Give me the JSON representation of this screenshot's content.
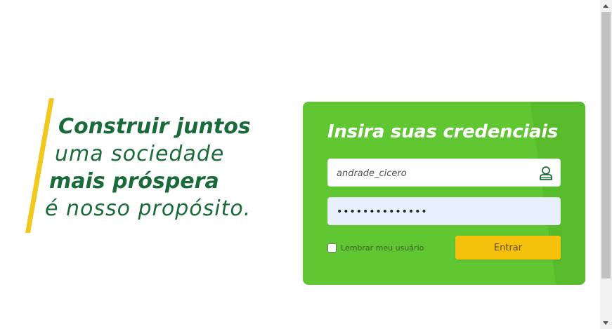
{
  "slogan": {
    "line1": "Construir juntos",
    "line2": "uma sociedade",
    "line3": "mais próspera",
    "line4": "é nosso propósito."
  },
  "login": {
    "title": "Insira suas credenciais",
    "username_value": "andrade_cicero",
    "password_value": "••••••••••••••",
    "remember_label": "Lembrar meu usuário",
    "submit_label": "Entrar"
  },
  "colors": {
    "brand_green": "#60c632",
    "dark_green": "#1a6b3a",
    "accent_yellow": "#f6c10d"
  },
  "icons": {
    "username": "user-icon"
  }
}
